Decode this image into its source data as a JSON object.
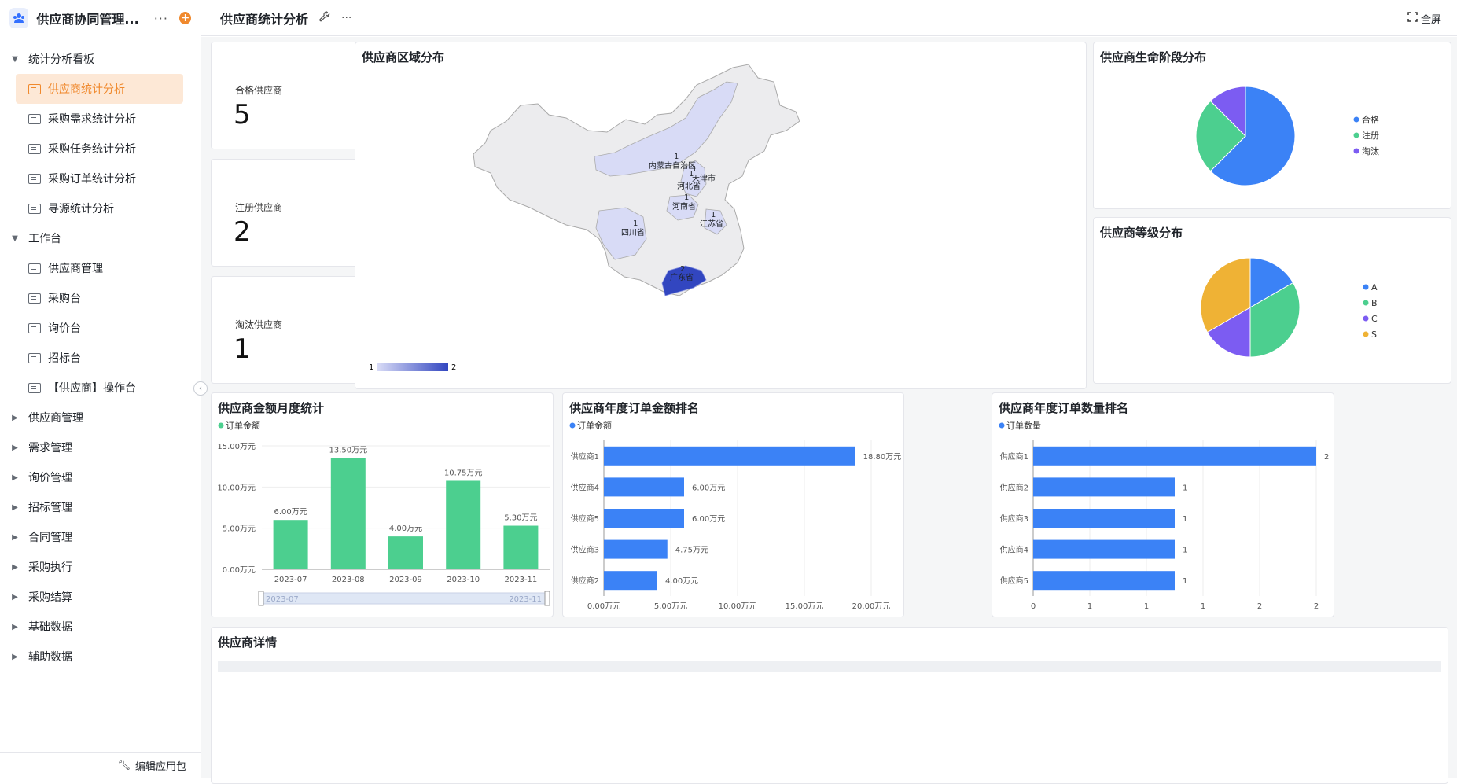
{
  "app": {
    "title": "供应商协同管理...",
    "more": "···",
    "add": "+"
  },
  "sidebar": {
    "items": [
      {
        "type": "group",
        "label": "统计分析看板",
        "open": true
      },
      {
        "type": "child",
        "label": "供应商统计分析",
        "active": true
      },
      {
        "type": "child",
        "label": "采购需求统计分析"
      },
      {
        "type": "child",
        "label": "采购任务统计分析"
      },
      {
        "type": "child",
        "label": "采购订单统计分析"
      },
      {
        "type": "child",
        "label": "寻源统计分析"
      },
      {
        "type": "group",
        "label": "工作台",
        "open": true
      },
      {
        "type": "child",
        "label": "供应商管理"
      },
      {
        "type": "child",
        "label": "采购台"
      },
      {
        "type": "child",
        "label": "询价台"
      },
      {
        "type": "child",
        "label": "招标台"
      },
      {
        "type": "child",
        "label": "【供应商】操作台"
      },
      {
        "type": "group",
        "label": "供应商管理",
        "open": false
      },
      {
        "type": "group",
        "label": "需求管理",
        "open": false
      },
      {
        "type": "group",
        "label": "询价管理",
        "open": false
      },
      {
        "type": "group",
        "label": "招标管理",
        "open": false
      },
      {
        "type": "group",
        "label": "合同管理",
        "open": false
      },
      {
        "type": "group",
        "label": "采购执行",
        "open": false
      },
      {
        "type": "group",
        "label": "采购结算",
        "open": false
      },
      {
        "type": "group",
        "label": "基础数据",
        "open": false
      },
      {
        "type": "group",
        "label": "辅助数据",
        "open": false
      }
    ],
    "footer": "编辑应用包"
  },
  "header": {
    "title": "供应商统计分析",
    "fullscreen": "全屏"
  },
  "stats": [
    {
      "label": "合格供应商",
      "value": "5"
    },
    {
      "label": "注册供应商",
      "value": "2"
    },
    {
      "label": "淘汰供应商",
      "value": "1"
    }
  ],
  "map": {
    "title": "供应商区域分布",
    "regions": [
      {
        "name": "内蒙古自治区",
        "value": 1
      },
      {
        "name": "天津市",
        "value": 1
      },
      {
        "name": "河北省",
        "value": 1
      },
      {
        "name": "河南省",
        "value": 1
      },
      {
        "name": "江苏省",
        "value": 1
      },
      {
        "name": "四川省",
        "value": 1
      },
      {
        "name": "广东省",
        "value": 2
      }
    ],
    "scale_min": "1",
    "scale_max": "2",
    "colors": {
      "low": "#d8dbf6",
      "high": "#3246c0",
      "base": "#ececee"
    }
  },
  "details": {
    "title": "供应商详情"
  },
  "chart_data": [
    {
      "type": "pie",
      "title": "供应商生命阶段分布",
      "categories": [
        "合格",
        "注册",
        "淘汰"
      ],
      "values": [
        5,
        2,
        1
      ],
      "colors": [
        "#3b82f6",
        "#4ccf8f",
        "#7c5cf2"
      ],
      "legend": "right"
    },
    {
      "type": "pie",
      "title": "供应商等级分布",
      "categories": [
        "A",
        "B",
        "C",
        "S"
      ],
      "values": [
        1,
        2,
        1,
        2
      ],
      "colors": [
        "#3b82f6",
        "#4ccf8f",
        "#7c5cf2",
        "#efb235"
      ],
      "legend": "right"
    },
    {
      "type": "bar",
      "title": "供应商金额月度统计",
      "series": [
        {
          "name": "订单金额",
          "values": [
            6.0,
            13.5,
            4.0,
            10.75,
            5.3
          ]
        }
      ],
      "categories": [
        "2023-07",
        "2023-08",
        "2023-09",
        "2023-10",
        "2023-11"
      ],
      "value_labels": [
        "6.00万元",
        "13.50万元",
        "4.00万元",
        "10.75万元",
        "5.30万元"
      ],
      "yticks": [
        "0.00万元",
        "5.00万元",
        "10.00万元",
        "15.00万元"
      ],
      "ylim": [
        0,
        15
      ],
      "color": "#4ccf8f",
      "slider": [
        "2023-07",
        "2023-11"
      ]
    },
    {
      "type": "bar",
      "orientation": "horizontal",
      "title": "供应商年度订单金额排名",
      "series": [
        {
          "name": "订单金额",
          "values": [
            18.8,
            6.0,
            6.0,
            4.75,
            4.0
          ]
        }
      ],
      "categories": [
        "供应商1",
        "供应商4",
        "供应商5",
        "供应商3",
        "供应商2"
      ],
      "value_labels": [
        "18.80万元",
        "6.00万元",
        "6.00万元",
        "4.75万元",
        "4.00万元"
      ],
      "xticks": [
        "0.00万元",
        "5.00万元",
        "10.00万元",
        "15.00万元",
        "20.00万元"
      ],
      "xlim": [
        0,
        20
      ],
      "color": "#3b82f6"
    },
    {
      "type": "bar",
      "orientation": "horizontal",
      "title": "供应商年度订单数量排名",
      "series": [
        {
          "name": "订单数量",
          "values": [
            2,
            1,
            1,
            1,
            1
          ]
        }
      ],
      "categories": [
        "供应商1",
        "供应商2",
        "供应商3",
        "供应商4",
        "供应商5"
      ],
      "value_labels": [
        "2",
        "1",
        "1",
        "1",
        "1"
      ],
      "xticks": [
        "0",
        "1",
        "1",
        "1",
        "2",
        "2"
      ],
      "xlim": [
        0,
        2
      ],
      "color": "#3b82f6"
    }
  ]
}
